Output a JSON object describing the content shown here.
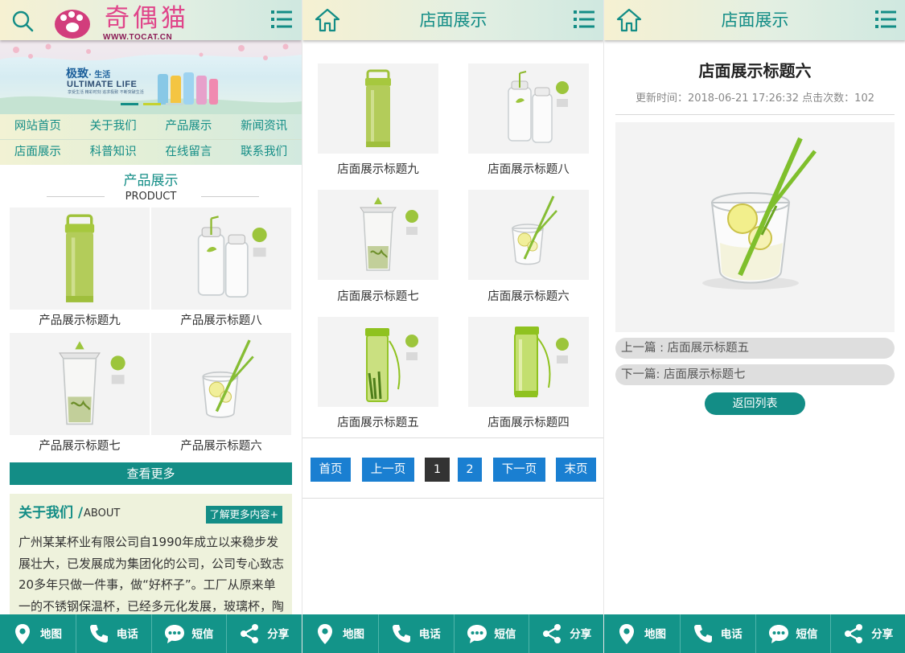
{
  "colors": {
    "teal": "#138d86",
    "footer": "#139489",
    "blue_button": "#1a7fd1",
    "current_page": "#333333",
    "tile_bg": "#f3f3f3"
  },
  "home": {
    "logo": {
      "brand": "奇偶猫",
      "url": "WWW.TOCAT.CN",
      "icon": "paw-icon"
    },
    "banner": {
      "kicker": "极致",
      "kicker_suffix": "· 生活",
      "title": "ULTIMATE LIFE",
      "tagline": "享受生活 精彩时刻 追求极致 不断突破生活"
    },
    "nav": [
      "网站首页",
      "关于我们",
      "产品展示",
      "新闻资讯",
      "店面展示",
      "科普知识",
      "在线留言",
      "联系我们"
    ],
    "section_title": "产品展示",
    "section_subtitle": "PRODUCT",
    "products": [
      {
        "caption": "产品展示标题九",
        "image": "tall-green-bottle"
      },
      {
        "caption": "产品展示标题八",
        "image": "two-clear-bottles"
      },
      {
        "caption": "产品展示标题七",
        "image": "tea-infuser-cup"
      },
      {
        "caption": "产品展示标题六",
        "image": "glass-with-straw"
      }
    ],
    "more_label": "查看更多",
    "about": {
      "heading": "关于我们 /",
      "heading_en": "ABOUT",
      "link": "了解更多内容+",
      "text": "广州某某杯业有限公司自1990年成立以来稳步发展壮大，已发展成为集团化的公司，公司专心致志20多年只做一件事，做“好杯子”。工厂从原来单一的不锈钢保温杯，已经多元化发展，玻璃杯，陶"
    }
  },
  "list": {
    "header_title": "店面展示",
    "items": [
      {
        "caption": "店面展示标题九",
        "image": "tall-green-bottle"
      },
      {
        "caption": "店面展示标题八",
        "image": "two-clear-bottles"
      },
      {
        "caption": "店面展示标题七",
        "image": "tea-infuser-cup"
      },
      {
        "caption": "店面展示标题六",
        "image": "glass-with-straw"
      },
      {
        "caption": "店面展示标题五",
        "image": "green-strap-bottle-a"
      },
      {
        "caption": "店面展示标题四",
        "image": "green-strap-bottle-b"
      }
    ],
    "pagination": {
      "first": "首页",
      "prev": "上一页",
      "pages": [
        "1",
        "2"
      ],
      "current": "1",
      "next": "下一页",
      "last": "末页"
    }
  },
  "detail": {
    "header_title": "店面展示",
    "title": "店面展示标题六",
    "meta": "更新时间：2018-06-21 17:26:32  点击次数：102",
    "image": "glass-with-straw",
    "prev": "上一篇 : 店面展示标题五",
    "next": "下一篇: 店面展示标题七",
    "back": "返回列表"
  },
  "footer": [
    {
      "label": "地图",
      "icon": "map-pin-icon"
    },
    {
      "label": "电话",
      "icon": "phone-icon"
    },
    {
      "label": "短信",
      "icon": "message-icon"
    },
    {
      "label": "分享",
      "icon": "share-icon"
    }
  ]
}
